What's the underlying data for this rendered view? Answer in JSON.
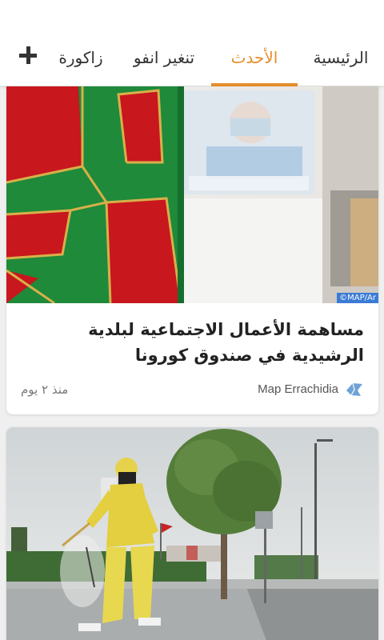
{
  "tabs": [
    {
      "label": "الرئيسية",
      "active": false
    },
    {
      "label": "الأحدث",
      "active": true
    },
    {
      "label": "تنغير انفو",
      "active": false
    },
    {
      "label": "زاكورة",
      "active": false
    }
  ],
  "add_icon": "plus-icon",
  "accent_color": "#e58d2c",
  "articles": [
    {
      "image_credit": "©MAP/Ar",
      "title": "مساهمة الأعمال الاجتماعية لبلدية الرشيدية في صندوق كورونا",
      "source": "Map Errachidia",
      "time": "منذ ٢ يوم"
    }
  ]
}
